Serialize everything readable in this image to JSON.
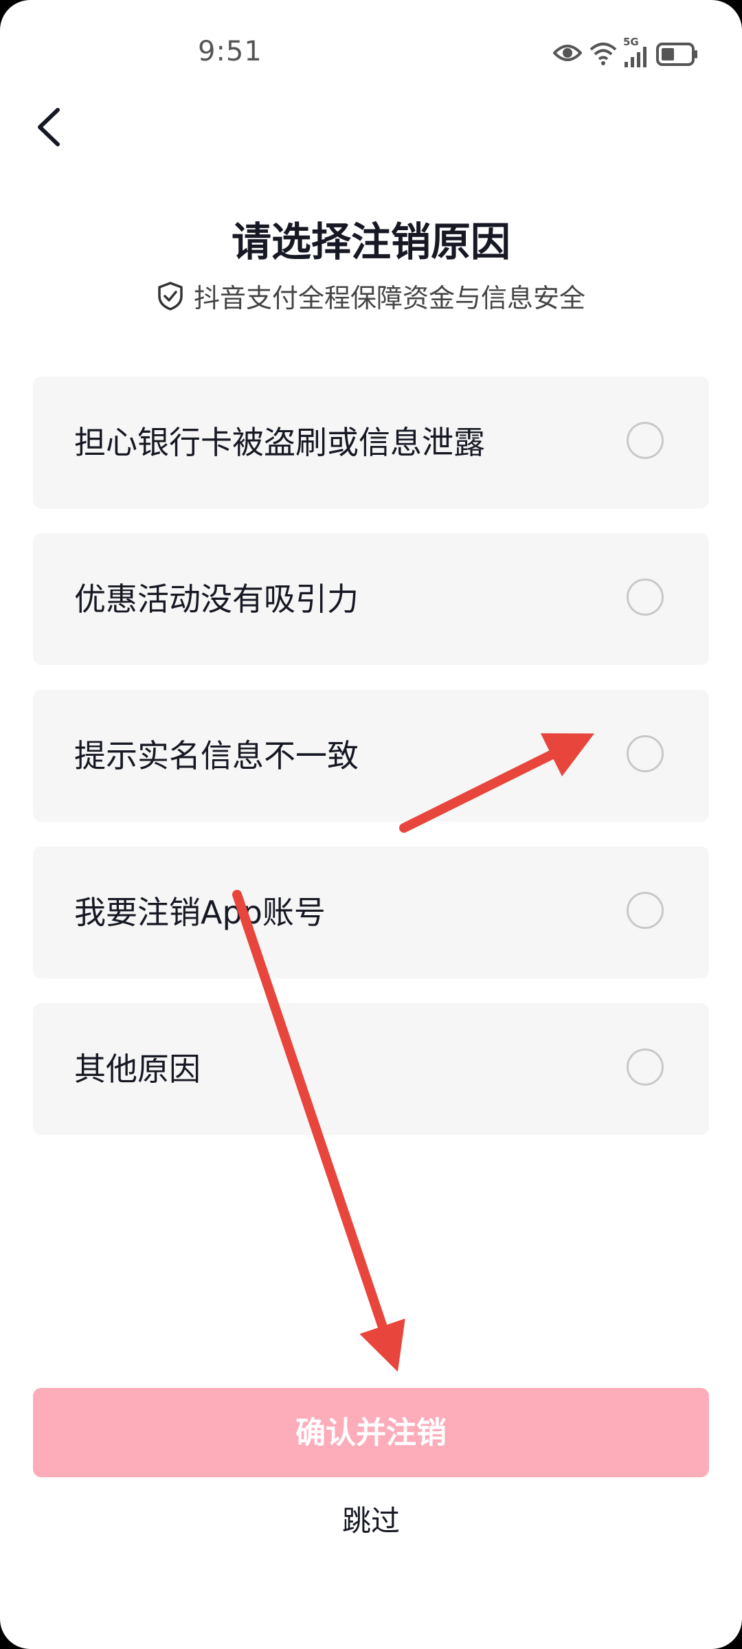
{
  "status_bar": {
    "time": "9:51",
    "network": "5G",
    "icons": [
      "eye-icon",
      "wifi-icon",
      "signal-icon",
      "battery-icon"
    ]
  },
  "header": {
    "back_icon": "chevron-left-icon",
    "title": "请选择注销原因",
    "subtitle": "抖音支付全程保障资金与信息安全",
    "subtitle_icon": "shield-check-icon"
  },
  "options": [
    {
      "label": "担心银行卡被盗刷或信息泄露",
      "selected": false
    },
    {
      "label": "优惠活动没有吸引力",
      "selected": false
    },
    {
      "label": "提示实名信息不一致",
      "selected": false
    },
    {
      "label": "我要注销App账号",
      "selected": false
    },
    {
      "label": "其他原因",
      "selected": false
    }
  ],
  "actions": {
    "confirm_label": "确认并注销",
    "skip_label": "跳过"
  },
  "colors": {
    "confirm_bg": "#fdacb9",
    "option_bg": "#f6f6f6",
    "annotation_arrow": "#e8453c"
  }
}
